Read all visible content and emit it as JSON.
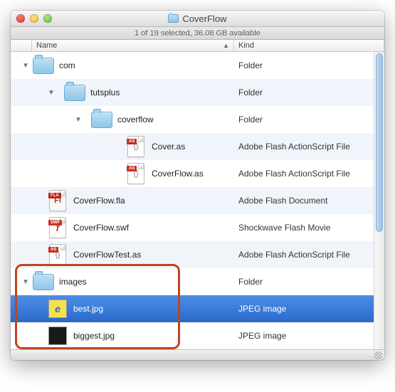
{
  "window": {
    "title": "CoverFlow",
    "status": "1 of 19 selected, 36.08 GB available"
  },
  "columns": {
    "name": "Name",
    "kind": "Kind"
  },
  "kinds": {
    "folder": "Folder",
    "as": "Adobe Flash ActionScript File",
    "fla": "Adobe Flash Document",
    "swf": "Shockwave Flash Movie",
    "jpeg": "JPEG image"
  },
  "rows": {
    "com": "com",
    "tutsplus": "tutsplus",
    "coverflow": "coverflow",
    "cover_as": "Cover.as",
    "coverflow_as": "CoverFlow.as",
    "coverflow_fla": "CoverFlow.fla",
    "coverflow_swf": "CoverFlow.swf",
    "coverflowtest_as": "CoverFlowTest.as",
    "images": "images",
    "best_jpg": "best.jpg",
    "biggest_jpg": "biggest.jpg"
  }
}
